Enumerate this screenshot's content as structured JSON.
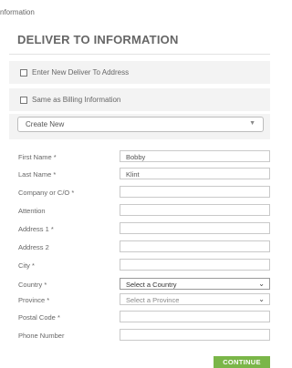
{
  "breadcrumb": "nformation",
  "panel": {
    "title": "DELIVER TO INFORMATION",
    "enter_new_label": "Enter New Deliver To Address",
    "same_billing_label": "Same as Billing Information",
    "address_select_value": "Create New"
  },
  "form": {
    "first_name_label": "First Name *",
    "first_name_value": "Bobby",
    "last_name_label": "Last Name *",
    "last_name_value": "Klint",
    "company_label": "Company or C/O *",
    "company_value": "",
    "attention_label": "Attention",
    "attention_value": "",
    "address1_label": "Address 1 *",
    "address1_value": "",
    "address2_label": "Address 2",
    "address2_value": "",
    "city_label": "City *",
    "city_value": "",
    "country_label": "Country *",
    "country_value": "Select a Country",
    "province_label": "Province *",
    "province_value": "Select a Province",
    "postal_label": "Postal Code *",
    "postal_value": "",
    "phone_label": "Phone Number",
    "phone_value": ""
  },
  "actions": {
    "continue_label": "CONTINUE"
  },
  "colors": {
    "continue_button": "#7ab648",
    "panel_gray": "#f3f3f3"
  }
}
